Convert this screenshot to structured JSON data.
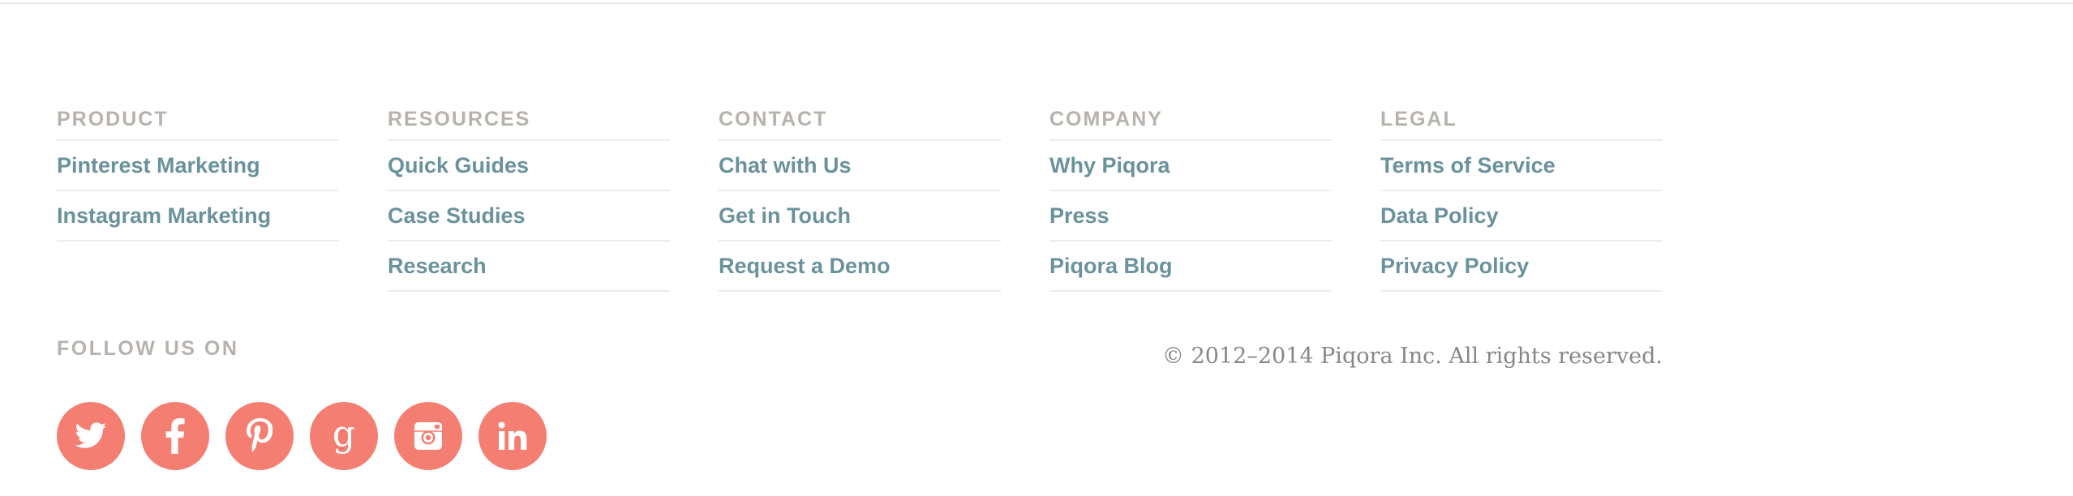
{
  "footer": {
    "columns": [
      {
        "heading": "PRODUCT",
        "links": [
          "Pinterest Marketing",
          "Instagram Marketing"
        ]
      },
      {
        "heading": "RESOURCES",
        "links": [
          "Quick Guides",
          "Case Studies",
          "Research"
        ]
      },
      {
        "heading": "CONTACT",
        "links": [
          "Chat with Us",
          "Get in Touch",
          "Request a Demo"
        ]
      },
      {
        "heading": "COMPANY",
        "links": [
          "Why Piqora",
          "Press",
          "Piqora Blog"
        ]
      },
      {
        "heading": "LEGAL",
        "links": [
          "Terms of Service",
          "Data Policy",
          "Privacy Policy"
        ]
      }
    ],
    "follow_heading": "FOLLOW US ON",
    "social_icons": [
      "twitter-icon",
      "facebook-icon",
      "pinterest-icon",
      "google-plus-icon",
      "instagram-icon",
      "linkedin-icon"
    ],
    "copyright": "© 2012–2014 Piqora Inc. All rights reserved."
  },
  "colors": {
    "heading": "#b7b2ac",
    "link": "#6a929c",
    "social_bg": "#f47e72",
    "divider": "#ececec",
    "copyright": "#8a8684"
  }
}
